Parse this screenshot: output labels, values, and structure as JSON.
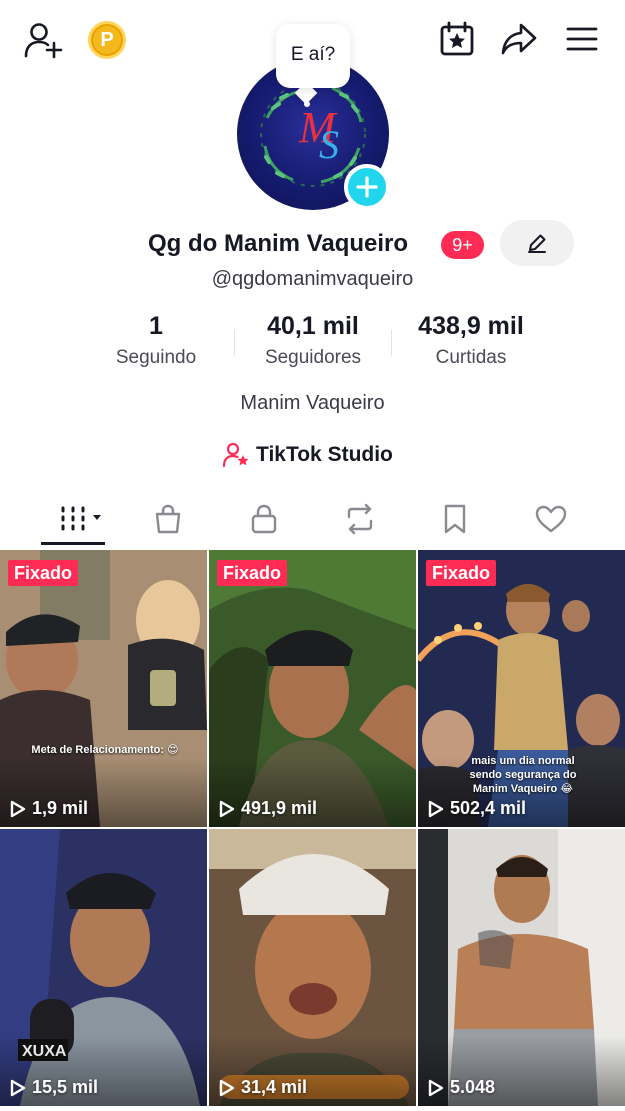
{
  "header": {
    "coin_letter": "P",
    "bubble_text": "E aí?"
  },
  "profile": {
    "name": "Qg do Manim Vaqueiro",
    "notification_badge": "9+",
    "username": "@qgdomanimvaqueiro",
    "bio": "Manim Vaqueiro",
    "studio_label": "TikTok Studio"
  },
  "stats": [
    {
      "value": "1",
      "label": "Seguindo"
    },
    {
      "value": "40,1 mil",
      "label": "Seguidores"
    },
    {
      "value": "438,9 mil",
      "label": "Curtidas"
    }
  ],
  "videos": [
    {
      "pinned": "Fixado",
      "views": "1,9 mil",
      "caption": "Meta de Relacionamento: 😍"
    },
    {
      "pinned": "Fixado",
      "views": "491,9 mil",
      "caption": ""
    },
    {
      "pinned": "Fixado",
      "views": "502,4 mil",
      "caption": "mais um dia normal sendo segurança do Manim Vaqueiro 😂"
    },
    {
      "pinned": "",
      "views": "15,5 mil",
      "caption": ""
    },
    {
      "pinned": "",
      "views": "31,4 mil",
      "caption": ""
    },
    {
      "pinned": "",
      "views": "5.048",
      "caption": ""
    }
  ],
  "colors": {
    "accent": "#fe2c55",
    "plus": "#20d5ec",
    "coin": "#f5b81c"
  },
  "icons": [
    "add-user-icon",
    "coin-icon",
    "calendar-star-icon",
    "share-icon",
    "menu-icon",
    "edit-icon",
    "tiktok-studio-icon",
    "grid-icon",
    "shop-bag-icon",
    "lock-icon",
    "repost-icon",
    "bookmark-icon",
    "heart-icon",
    "play-icon"
  ]
}
